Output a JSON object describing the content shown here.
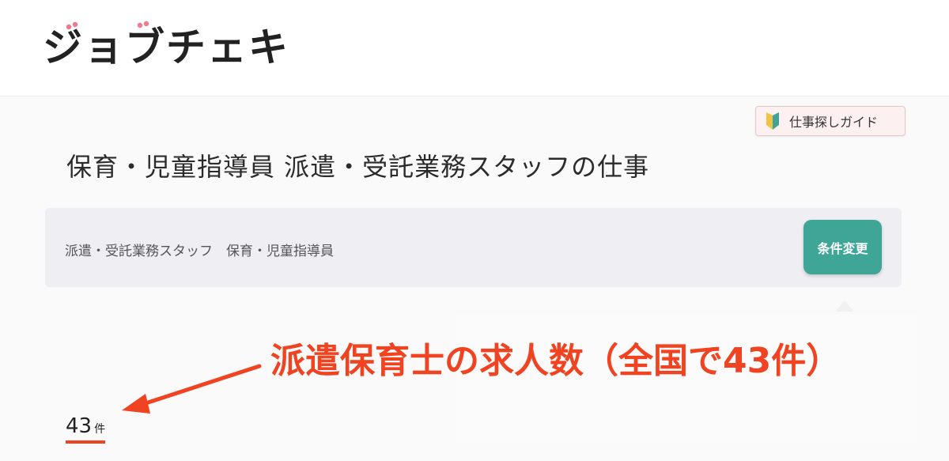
{
  "header": {
    "logo_text": "ジョブチェキ"
  },
  "guide_button": {
    "label": "仕事探しガイド",
    "icon": "beginner-leaf-icon"
  },
  "page": {
    "title": "保育・児童指導員 派遣・受託業務スタッフの仕事"
  },
  "search_conditions": {
    "text": "派遣・受託業務スタッフ　保育・児童指導員",
    "change_button_label": "条件変更"
  },
  "annotation": {
    "text": "派遣保育士の求人数（全国で43件）"
  },
  "results": {
    "count": "43",
    "unit": "件"
  },
  "colors": {
    "accent_button": "#3fa596",
    "annotation_red": "#f04321",
    "logo_dot_pink": "#f07a8c"
  }
}
